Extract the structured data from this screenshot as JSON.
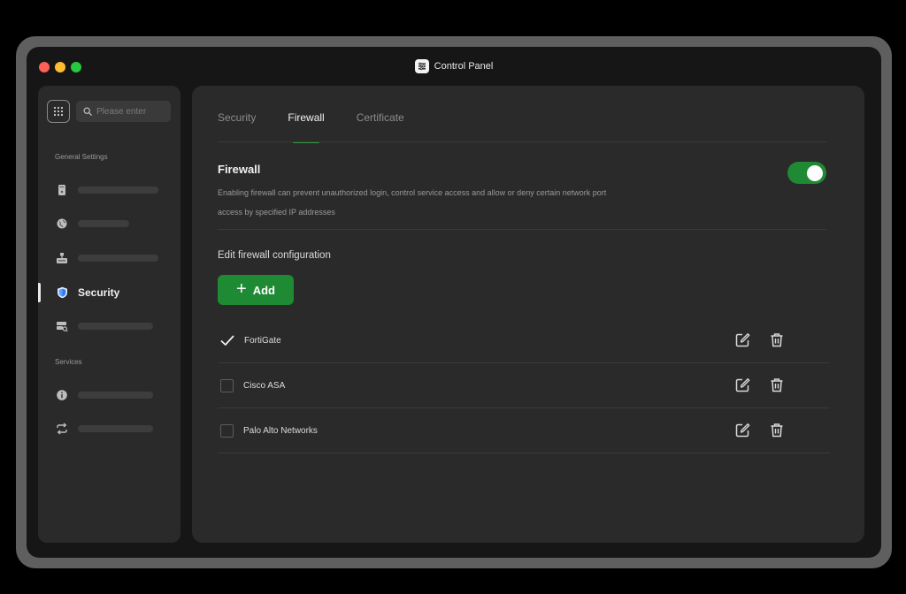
{
  "window": {
    "title": "Control Panel"
  },
  "sidebar": {
    "search_placeholder": "Please enter",
    "general_section_label": "General Settings",
    "services_section_label": "Services",
    "items": [
      {
        "icon": "drive-icon",
        "label": ""
      },
      {
        "icon": "globe-icon",
        "label": ""
      },
      {
        "icon": "network-icon",
        "label": ""
      },
      {
        "icon": "shield-icon",
        "label": "Security",
        "active": true
      },
      {
        "icon": "storage-search-icon",
        "label": ""
      },
      {
        "icon": "info-icon",
        "label": ""
      },
      {
        "icon": "sync-icon",
        "label": ""
      }
    ]
  },
  "tabs": [
    {
      "label": "Security"
    },
    {
      "label": "Firewall",
      "active": true
    },
    {
      "label": "Certificate"
    }
  ],
  "firewall": {
    "title": "Firewall",
    "description": "Enabling firewall can prevent unauthorized login, control service access and allow or deny certain network port access by specified IP addresses",
    "enabled": true,
    "edit_label": "Edit firewall configuration",
    "add_label": "Add",
    "entries": [
      {
        "name": "FortiGate",
        "checked": true
      },
      {
        "name": "Cisco ASA",
        "checked": false
      },
      {
        "name": "Palo Alto Networks",
        "checked": false
      }
    ]
  },
  "colors": {
    "accent": "#1f8a34",
    "background": "#161616",
    "panel": "#2a2a2a"
  }
}
